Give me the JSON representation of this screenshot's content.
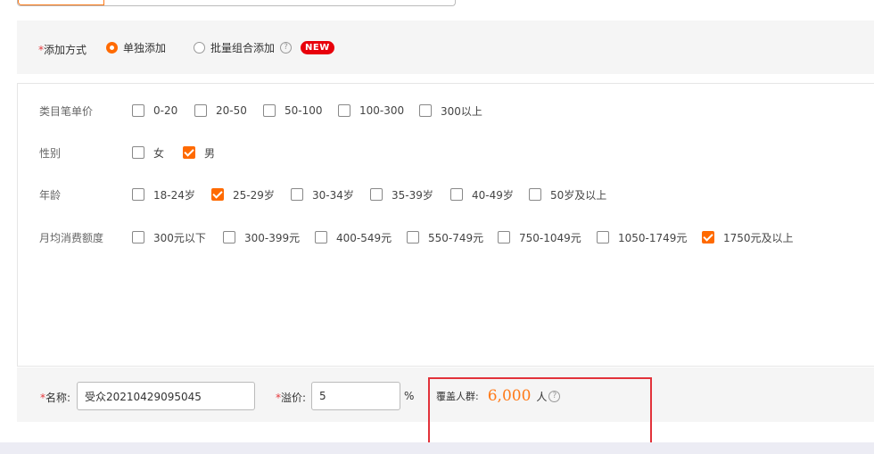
{
  "method": {
    "required_mark": "*",
    "label": "添加方式",
    "option_single": "单独添加",
    "option_batch": "批量组合添加",
    "help_icon": "question-circle-icon",
    "new_badge": "NEW"
  },
  "filters": {
    "price": {
      "label": "类目笔单价",
      "options": [
        {
          "label": "0-20",
          "checked": false
        },
        {
          "label": "20-50",
          "checked": false
        },
        {
          "label": "50-100",
          "checked": false
        },
        {
          "label": "100-300",
          "checked": false
        },
        {
          "label": "300以上",
          "checked": false
        }
      ]
    },
    "gender": {
      "label": "性别",
      "options": [
        {
          "label": "女",
          "checked": false
        },
        {
          "label": "男",
          "checked": true
        }
      ]
    },
    "age": {
      "label": "年龄",
      "options": [
        {
          "label": "18-24岁",
          "checked": false
        },
        {
          "label": "25-29岁",
          "checked": true
        },
        {
          "label": "30-34岁",
          "checked": false
        },
        {
          "label": "35-39岁",
          "checked": false
        },
        {
          "label": "40-49岁",
          "checked": false
        },
        {
          "label": "50岁及以上",
          "checked": false
        }
      ]
    },
    "spend": {
      "label": "月均消费额度",
      "options": [
        {
          "label": "300元以下",
          "checked": false
        },
        {
          "label": "300-399元",
          "checked": false
        },
        {
          "label": "400-549元",
          "checked": false
        },
        {
          "label": "550-749元",
          "checked": false
        },
        {
          "label": "750-1049元",
          "checked": false
        },
        {
          "label": "1050-1749元",
          "checked": false
        },
        {
          "label": "1750元及以上",
          "checked": true
        }
      ]
    }
  },
  "bottom": {
    "name_label": "名称:",
    "name_value": "受众20210429095045",
    "premium_label": "溢价:",
    "premium_value": "5",
    "percent": "%",
    "coverage_label": "覆盖人群:",
    "coverage_value": "6,000",
    "coverage_unit": "人"
  },
  "colors": {
    "accent": "#ff6a00",
    "required": "#e4393c",
    "highlight": "#e2323a",
    "new_badge": "#e8000b"
  }
}
